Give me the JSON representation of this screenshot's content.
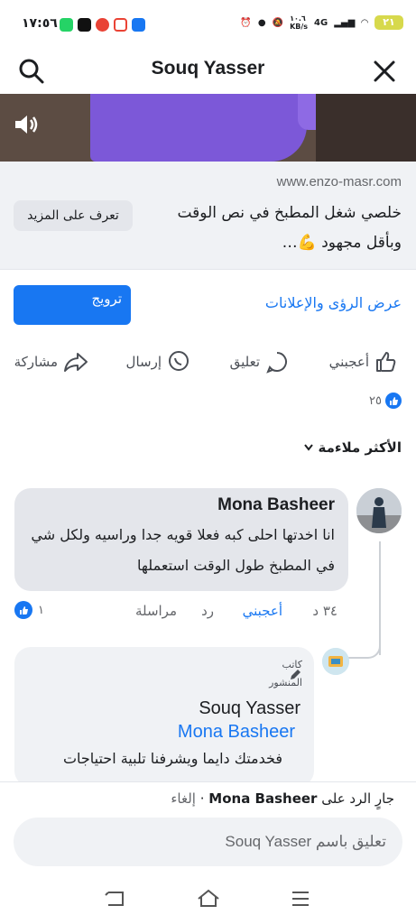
{
  "status_bar": {
    "time": "١٧:٥٦",
    "net_speed": "١٠.٦\nKB/s",
    "network": "4G",
    "battery": "٢١"
  },
  "header": {
    "title": "Souq Yasser",
    "search_icon": "search-icon",
    "close_icon": "close-icon"
  },
  "video": {
    "sound_icon": "volume-icon"
  },
  "ad": {
    "domain": "www.enzo-masr.com",
    "headline": "خلصي شغل المطبخ في نص الوقت وبأقل مجهود 💪…",
    "learn_more": "تعرف على المزيد"
  },
  "promotion": {
    "promote_label": "ترويج",
    "insights_link": "عرض الرؤى والإعلانات"
  },
  "actions": {
    "like": "أعجبني",
    "comment": "تعليق",
    "send": "إرسال",
    "share": "مشاركة"
  },
  "reactions": {
    "count": "٢٥"
  },
  "sort": {
    "label": "الأكثر ملاءمة"
  },
  "comment": {
    "author": "Mona Basheer",
    "text": "انا اخدتها احلى كبه فعلا قويه جدا وراسيه ولكل شي في المطبخ  طول الوقت استعملها",
    "time": "٣٤ د",
    "like_label": "أعجبني",
    "reply_label": "رد",
    "message_label": "مراسلة",
    "likes_count": "١"
  },
  "reply": {
    "badge_line1": "كاتب",
    "badge_line2": "المنشور",
    "author": "Souq Yasser",
    "tag": "Mona Basheer",
    "text": "فخدمتك دايما ويشرفنا تلبية احتياجات"
  },
  "replying_to": {
    "prefix": "جارٍ الرد على",
    "name": "Mona Basheer",
    "separator": "·",
    "cancel": "إلغاء"
  },
  "composer": {
    "placeholder": "تعليق باسم Souq Yasser"
  },
  "colors": {
    "accent": "#1877f2",
    "bubble": "#e4e6eb",
    "panel": "#f0f2f5"
  }
}
